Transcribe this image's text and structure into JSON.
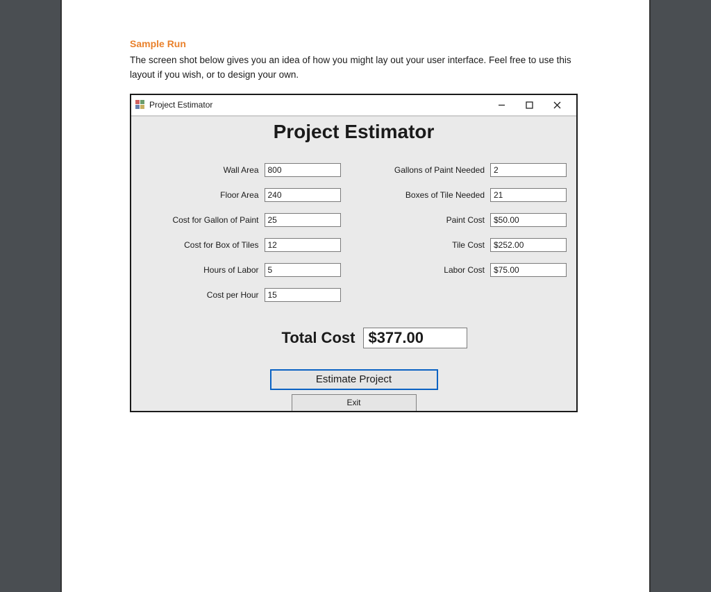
{
  "doc": {
    "heading": "Sample Run",
    "description": "The screen shot below gives you an idea of how you might lay out your user interface. Feel free to use this layout if you wish, or to design your own."
  },
  "window": {
    "title": "Project Estimator",
    "form_heading": "Project Estimator"
  },
  "inputs": {
    "wall_area": {
      "label": "Wall Area",
      "value": "800"
    },
    "floor_area": {
      "label": "Floor Area",
      "value": "240"
    },
    "cost_paint": {
      "label": "Cost for Gallon of Paint",
      "value": "25"
    },
    "cost_tile": {
      "label": "Cost for Box of Tiles",
      "value": "12"
    },
    "hours": {
      "label": "Hours of Labor",
      "value": "5"
    },
    "cost_hour": {
      "label": "Cost per Hour",
      "value": "15"
    }
  },
  "outputs": {
    "gallons": {
      "label": "Gallons of Paint Needed",
      "value": "2"
    },
    "boxes": {
      "label": "Boxes of Tile Needed",
      "value": "21"
    },
    "paint_cost": {
      "label": "Paint Cost",
      "value": "$50.00"
    },
    "tile_cost": {
      "label": "Tile Cost",
      "value": "$252.00"
    },
    "labor_cost": {
      "label": "Labor Cost",
      "value": "$75.00"
    }
  },
  "total": {
    "label": "Total Cost",
    "value": "$377.00"
  },
  "buttons": {
    "estimate": "Estimate Project",
    "exit": "Exit"
  }
}
